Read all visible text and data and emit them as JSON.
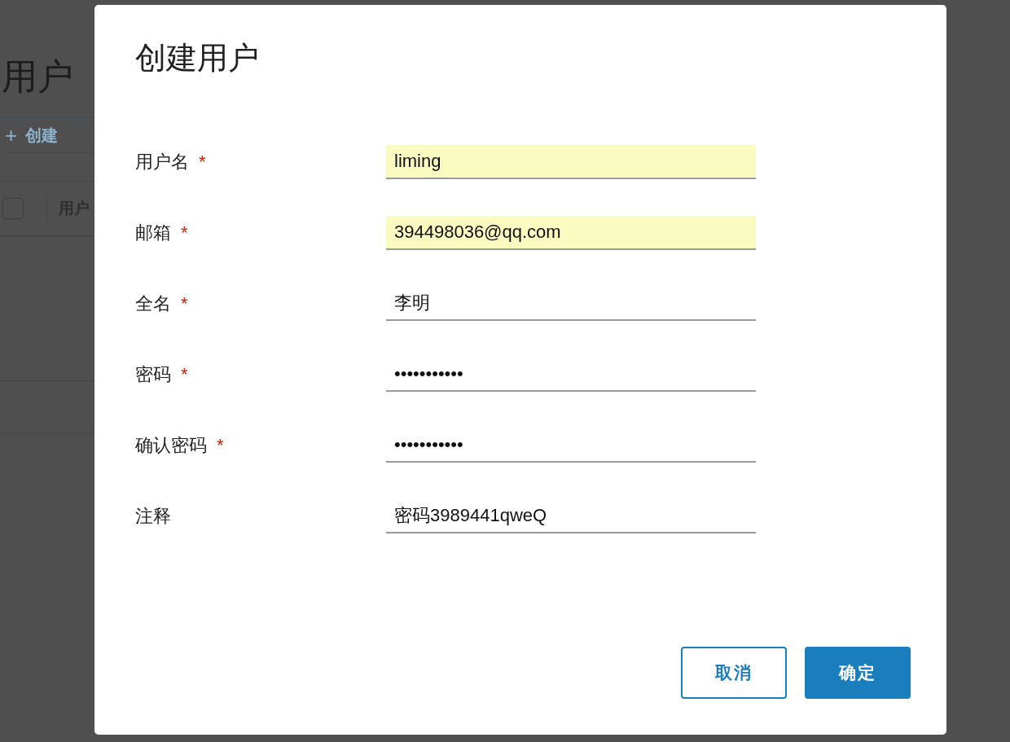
{
  "background_page": {
    "title": "用户",
    "create_button": {
      "icon": "+",
      "label": "创建"
    },
    "table": {
      "select_all_checked": false,
      "columns": [
        "用户"
      ]
    }
  },
  "dialog": {
    "title": "创建用户",
    "required_mark": "*",
    "fields": [
      {
        "label": "用户名",
        "required": true,
        "value": "liming",
        "autofilled": true
      },
      {
        "label": "邮箱",
        "required": true,
        "value": "394498036@qq.com",
        "autofilled": true
      },
      {
        "label": "全名",
        "required": true,
        "value": "李明",
        "autofilled": false
      },
      {
        "label": "密码",
        "required": true,
        "value": "•••••••••••",
        "autofilled": false
      },
      {
        "label": "确认密码",
        "required": true,
        "value": "•••••••••••",
        "autofilled": false
      },
      {
        "label": "注释",
        "required": false,
        "value": "密码3989441qweQ",
        "autofilled": false
      }
    ],
    "buttons": [
      {
        "label": "取消",
        "kind": "secondary"
      },
      {
        "label": "确定",
        "kind": "primary"
      }
    ]
  }
}
